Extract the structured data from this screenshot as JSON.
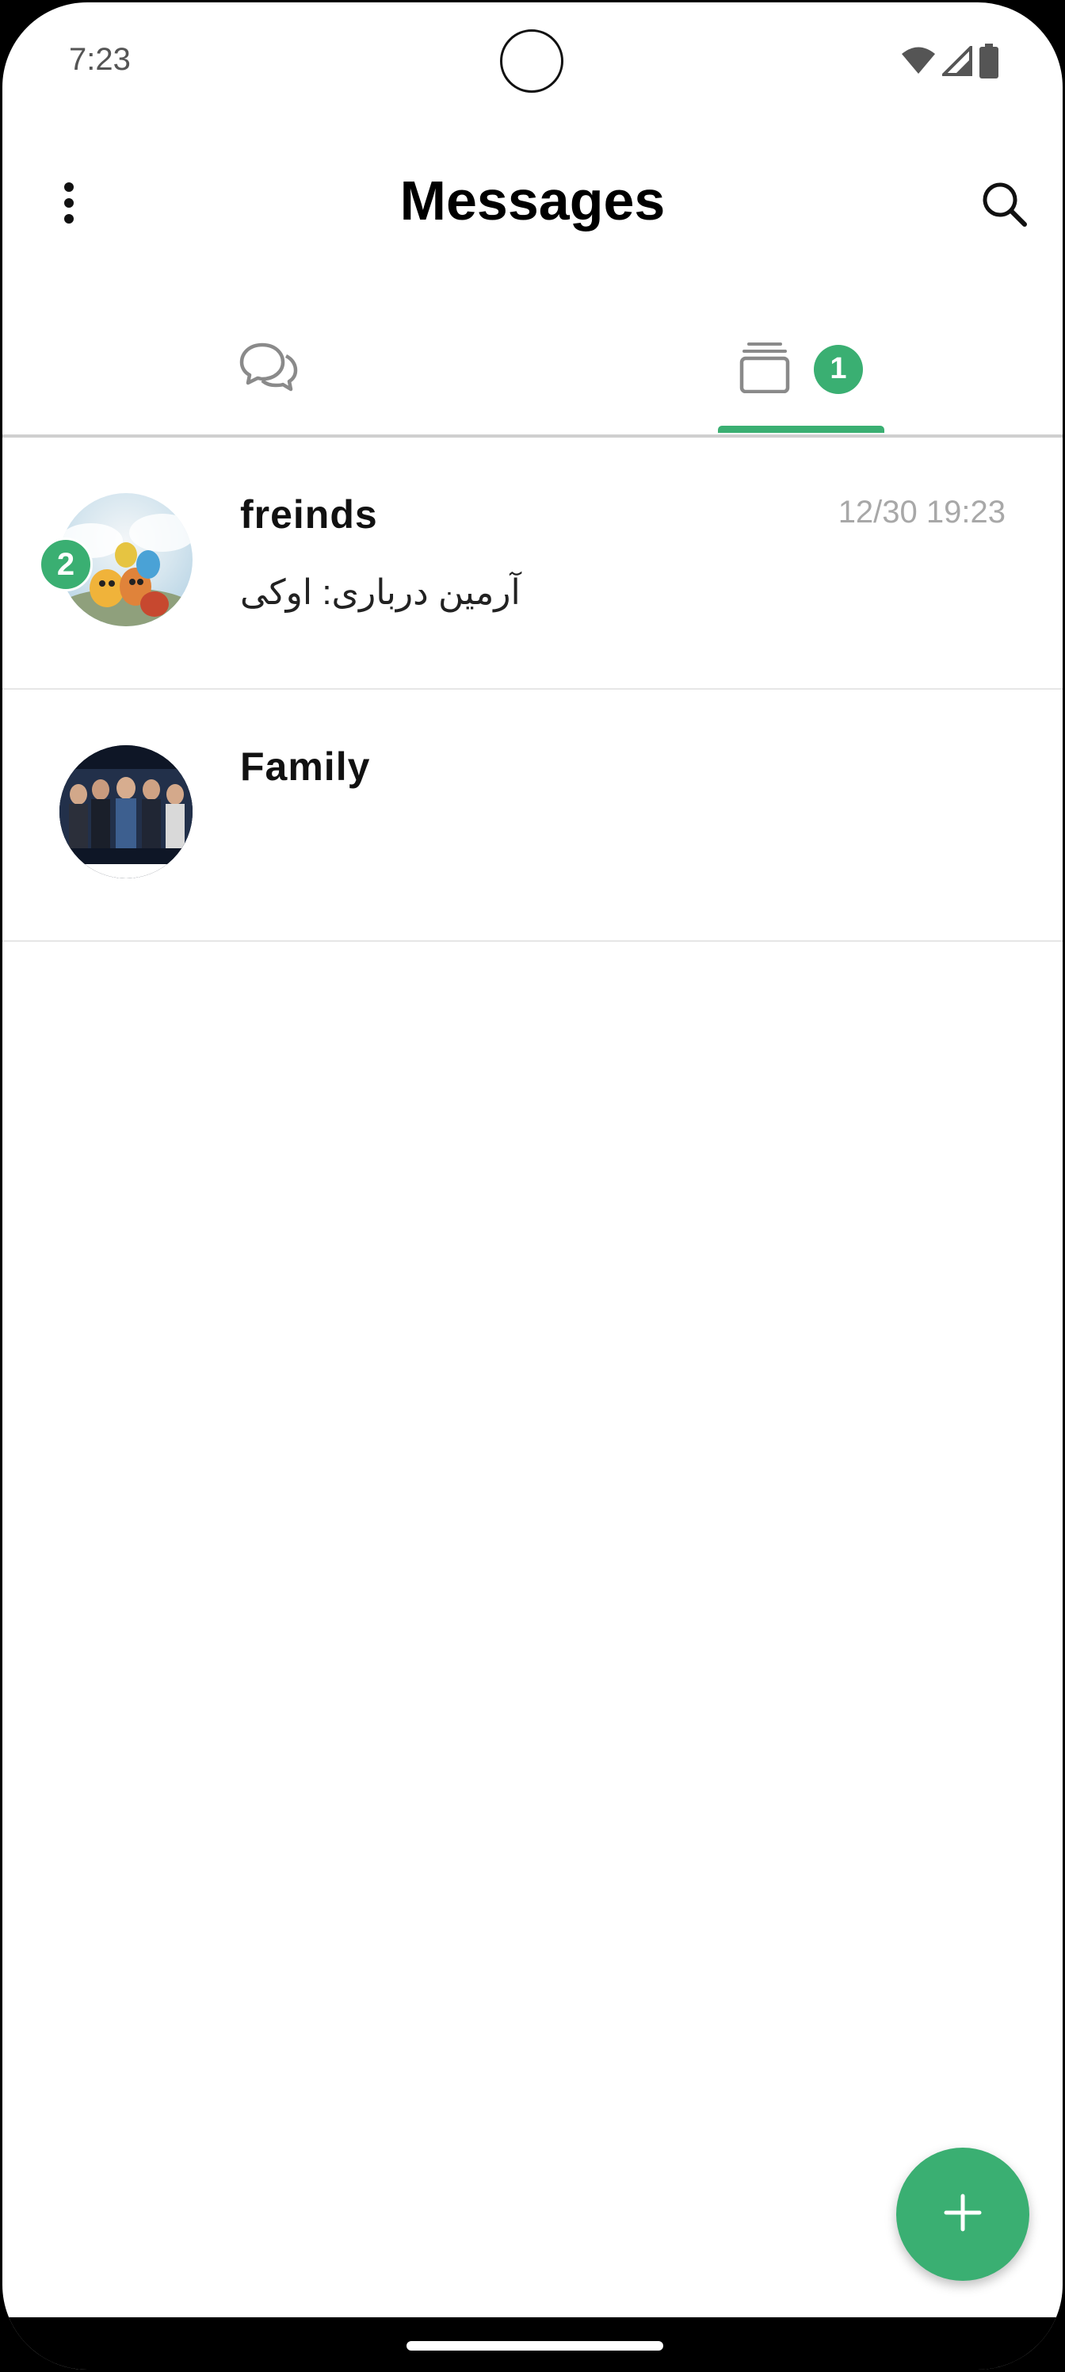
{
  "status_bar": {
    "time": "7:23",
    "icons": [
      "wifi-icon",
      "cellular-signal-icon",
      "battery-icon"
    ]
  },
  "header": {
    "title": "Messages",
    "menu_icon": "more-vert-icon",
    "search_icon": "search-icon"
  },
  "tabs": [
    {
      "name": "chats",
      "icon": "chat-bubbles-icon",
      "active": false
    },
    {
      "name": "groups",
      "icon": "stacked-cards-icon",
      "badge": "1",
      "active": true
    }
  ],
  "conversations": [
    {
      "name": "freinds",
      "time": "12/30 19:23",
      "preview": "آرمین درباری: اوکی",
      "unread": "2"
    },
    {
      "name": "Family",
      "time": "",
      "preview": "",
      "unread": ""
    }
  ],
  "fab": {
    "icon": "plus-icon"
  },
  "colors": {
    "accent": "#3aaf72",
    "timestamp": "#a8a8a8",
    "divider": "#e6e6e6"
  }
}
